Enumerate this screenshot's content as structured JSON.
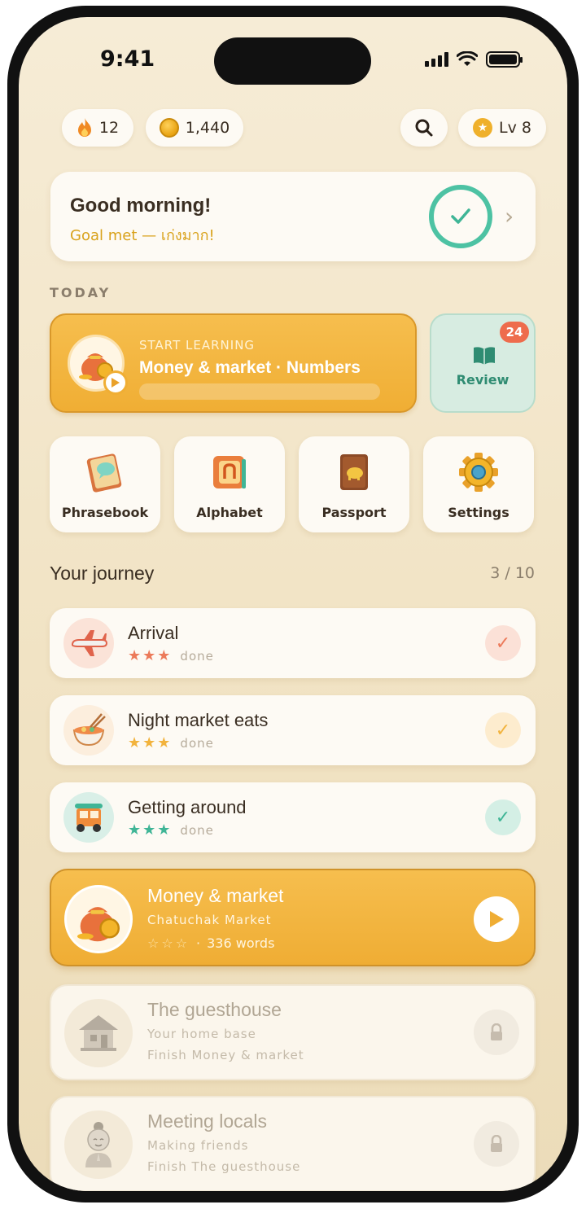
{
  "status": {
    "time": "9:41"
  },
  "top": {
    "streak": "12",
    "coins": "1,440",
    "level": "Lv 8"
  },
  "greeting": {
    "title": "Good morning!",
    "subtitle": "Goal met — เก่งมาก!"
  },
  "today_label": "TODAY",
  "start": {
    "kicker": "START LEARNING",
    "title": "Money & market · Numbers",
    "progress": 0
  },
  "review": {
    "label": "Review",
    "badge": "24"
  },
  "tiles": [
    {
      "label": "Phrasebook",
      "icon": "phrasebook-icon"
    },
    {
      "label": "Alphabet",
      "icon": "alphabet-block-icon"
    },
    {
      "label": "Passport",
      "icon": "passport-icon"
    },
    {
      "label": "Settings",
      "icon": "gear-icon"
    }
  ],
  "journey": {
    "title": "Your journey",
    "count": "3 / 10",
    "completed": [
      {
        "title": "Arrival",
        "stars": "★★★",
        "status": "done",
        "icon": "airplane-icon",
        "accent": "#ec7a5a"
      },
      {
        "title": "Night market eats",
        "stars": "★★★",
        "status": "done",
        "icon": "noodle-bowl-icon",
        "accent": "#f2b33d"
      },
      {
        "title": "Getting around",
        "stars": "★★★",
        "status": "done",
        "icon": "tuk-tuk-icon",
        "accent": "#3fb596"
      }
    ],
    "current": {
      "title": "Money & market",
      "place": "Chatuchak Market",
      "stars": "☆☆☆",
      "words": "336 words",
      "separator": "·"
    },
    "locked": [
      {
        "title": "The guesthouse",
        "subtitle": "Your home base",
        "requirement": "Finish Money & market",
        "icon": "house-icon"
      },
      {
        "title": "Meeting locals",
        "subtitle": "Making friends",
        "requirement": "Finish The guesthouse",
        "icon": "person-wai-icon"
      }
    ]
  },
  "colors": {
    "accent": "#f0ae34",
    "success": "#4dc2a3",
    "badge": "#ee6c4d"
  }
}
